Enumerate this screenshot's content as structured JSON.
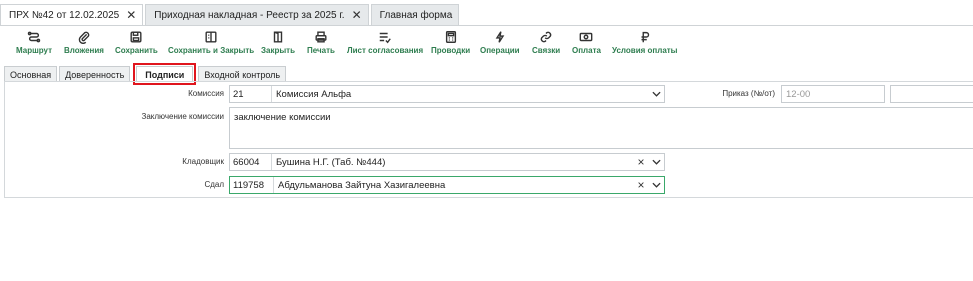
{
  "window_tabs": [
    {
      "label": "ПРХ №42 от 12.02.2025"
    },
    {
      "label": "Приходная накладная - Реестр за 2025 г."
    },
    {
      "label": "Главная форма"
    }
  ],
  "toolbar": {
    "route": "Маршрут",
    "attachments": "Вложения",
    "save": "Сохранить",
    "save_close": "Сохранить и Закрыть",
    "close": "Закрыть",
    "print": "Печать",
    "approval_sheet": "Лист согласования",
    "postings": "Проводки",
    "operations": "Операции",
    "links": "Связки",
    "payment": "Оплата",
    "payment_terms": "Условия оплаты"
  },
  "form_tabs": {
    "main": "Основная",
    "power_of_attorney": "Доверенность",
    "signatures": "Подписи",
    "incoming_control": "Входной контроль"
  },
  "form": {
    "commission_label": "Комиссия",
    "commission_code": "21",
    "commission_name": "Комиссия Альфа",
    "order_label": "Приказ (№/от)",
    "order_number_placeholder": "12-00",
    "conclusion_label": "Заключение комиссии",
    "conclusion_value": "заключение комиссии",
    "storekeeper_label": "Кладовщик",
    "storekeeper_code": "66004",
    "storekeeper_name": "Бушина Н.Г. (Таб. №444)",
    "handed_label": "Сдал",
    "handed_code": "119758",
    "handed_name": "Абдульманова Зайтуна Хазигалеевна"
  },
  "colors": {
    "accent_green": "#2e7d4f",
    "highlight_red": "#e0151d"
  }
}
